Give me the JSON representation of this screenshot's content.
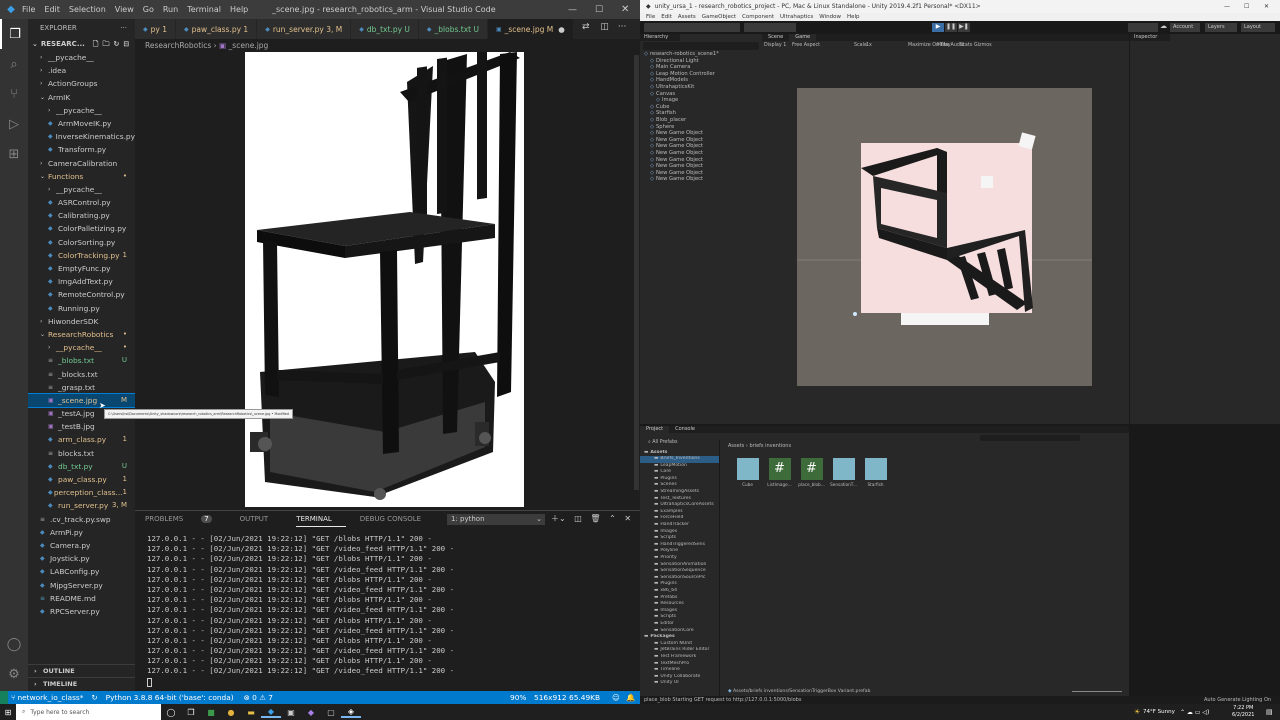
{
  "vscode": {
    "menu": [
      "File",
      "Edit",
      "Selection",
      "View",
      "Go",
      "Run",
      "Terminal",
      "Help"
    ],
    "title": "_scene.jpg - research_robotics_arm - Visual Studio Code",
    "explorer_label": "EXPLORER",
    "explorer_root": "RESEARC...",
    "tree": [
      {
        "label": "__pycache__",
        "indent": 1,
        "folder": true,
        "color": "#ccc",
        "badge": ""
      },
      {
        "label": ".idea",
        "indent": 1,
        "folder": true,
        "color": "#ccc",
        "badge": ""
      },
      {
        "label": "ActionGroups",
        "indent": 1,
        "folder": true,
        "color": "#ccc",
        "badge": ""
      },
      {
        "label": "ArmIK",
        "indent": 1,
        "folder": true,
        "open": true,
        "color": "#ccc",
        "badge": ""
      },
      {
        "label": "__pycache__",
        "indent": 2,
        "folder": true,
        "color": "#ccc",
        "badge": ""
      },
      {
        "label": "ArmMoveIK.py",
        "indent": 2,
        "file": "py",
        "color": "#ccc",
        "badge": ""
      },
      {
        "label": "InverseKinematics.py",
        "indent": 2,
        "file": "py",
        "color": "#ccc",
        "badge": ""
      },
      {
        "label": "Transform.py",
        "indent": 2,
        "file": "py",
        "color": "#ccc",
        "badge": ""
      },
      {
        "label": "CameraCalibration",
        "indent": 1,
        "folder": true,
        "color": "#ccc",
        "badge": ""
      },
      {
        "label": "Functions",
        "indent": 1,
        "folder": true,
        "open": true,
        "color": "#e2c08d",
        "badge": "•"
      },
      {
        "label": "__pycache__",
        "indent": 2,
        "folder": true,
        "color": "#ccc",
        "badge": ""
      },
      {
        "label": "ASRControl.py",
        "indent": 2,
        "file": "py",
        "color": "#ccc",
        "badge": ""
      },
      {
        "label": "Calibrating.py",
        "indent": 2,
        "file": "py",
        "color": "#ccc",
        "badge": ""
      },
      {
        "label": "ColorPalletizing.py",
        "indent": 2,
        "file": "py",
        "color": "#ccc",
        "badge": ""
      },
      {
        "label": "ColorSorting.py",
        "indent": 2,
        "file": "py",
        "color": "#ccc",
        "badge": ""
      },
      {
        "label": "ColorTracking.py",
        "indent": 2,
        "file": "py",
        "color": "#e2c08d",
        "badge": "1"
      },
      {
        "label": "EmptyFunc.py",
        "indent": 2,
        "file": "py",
        "color": "#ccc",
        "badge": ""
      },
      {
        "label": "ImgAddText.py",
        "indent": 2,
        "file": "py",
        "color": "#ccc",
        "badge": ""
      },
      {
        "label": "RemoteControl.py",
        "indent": 2,
        "file": "py",
        "color": "#ccc",
        "badge": ""
      },
      {
        "label": "Running.py",
        "indent": 2,
        "file": "py",
        "color": "#ccc",
        "badge": ""
      },
      {
        "label": "HiwonderSDK",
        "indent": 1,
        "folder": true,
        "color": "#ccc",
        "badge": ""
      },
      {
        "label": "ResearchRobotics",
        "indent": 1,
        "folder": true,
        "open": true,
        "color": "#e2c08d",
        "badge": "•"
      },
      {
        "label": "__pycache__",
        "indent": 2,
        "folder": true,
        "color": "#e2c08d",
        "badge": "•"
      },
      {
        "label": "_blobs.txt",
        "indent": 2,
        "file": "txt",
        "color": "#73c991",
        "badge": "U"
      },
      {
        "label": "_blocks.txt",
        "indent": 2,
        "file": "txt",
        "color": "#ccc",
        "badge": ""
      },
      {
        "label": "_grasp.txt",
        "indent": 2,
        "file": "txt",
        "color": "#ccc",
        "badge": ""
      },
      {
        "label": "_scene.jpg",
        "indent": 2,
        "file": "img",
        "color": "#e2c08d",
        "badge": "M",
        "selected": true
      },
      {
        "label": "_testA.jpg",
        "indent": 2,
        "file": "img",
        "color": "#ccc",
        "badge": ""
      },
      {
        "label": "_testB.jpg",
        "indent": 2,
        "file": "img",
        "color": "#ccc",
        "badge": ""
      },
      {
        "label": "arm_class.py",
        "indent": 2,
        "file": "py",
        "color": "#e2c08d",
        "badge": "1"
      },
      {
        "label": "blocks.txt",
        "indent": 2,
        "file": "txt",
        "color": "#ccc",
        "badge": ""
      },
      {
        "label": "db_txt.py",
        "indent": 2,
        "file": "py",
        "color": "#73c991",
        "badge": "U"
      },
      {
        "label": "paw_class.py",
        "indent": 2,
        "file": "py",
        "color": "#e2c08d",
        "badge": "1"
      },
      {
        "label": "perception_class...",
        "indent": 2,
        "file": "py",
        "color": "#e2c08d",
        "badge": "1"
      },
      {
        "label": "run_server.py",
        "indent": 2,
        "file": "py",
        "color": "#e2c08d",
        "badge": "3, M"
      },
      {
        "label": ".cv_track.py.swp",
        "indent": 1,
        "file": "txt",
        "color": "#ccc",
        "badge": ""
      },
      {
        "label": "ArmPi.py",
        "indent": 1,
        "file": "py",
        "color": "#ccc",
        "badge": ""
      },
      {
        "label": "Camera.py",
        "indent": 1,
        "file": "py",
        "color": "#ccc",
        "badge": ""
      },
      {
        "label": "Joystick.py",
        "indent": 1,
        "file": "py",
        "color": "#ccc",
        "badge": ""
      },
      {
        "label": "LABConfig.py",
        "indent": 1,
        "file": "py",
        "color": "#ccc",
        "badge": ""
      },
      {
        "label": "MjpgServer.py",
        "indent": 1,
        "file": "py",
        "color": "#ccc",
        "badge": ""
      },
      {
        "label": "README.md",
        "indent": 1,
        "file": "md",
        "color": "#ccc",
        "badge": ""
      },
      {
        "label": "RPCServer.py",
        "indent": 1,
        "file": "py",
        "color": "#ccc",
        "badge": ""
      }
    ],
    "outline": "OUTLINE",
    "timeline": "TIMELINE",
    "tabs": [
      {
        "label": "py 1",
        "color": "#e2c08d"
      },
      {
        "label": "paw_class.py 1",
        "color": "#e2c08d"
      },
      {
        "label": "run_server.py 3, M",
        "color": "#e2c08d"
      },
      {
        "label": "db_txt.py U",
        "color": "#73c991"
      },
      {
        "label": "_blobs.txt U",
        "color": "#73c991"
      },
      {
        "label": "_scene.jpg M",
        "color": "#e2c08d",
        "active": true
      }
    ],
    "breadcrumb": [
      "ResearchRobotics",
      "_scene.jpg"
    ],
    "tooltip": "C:\\Users\\hsl\\Documents\\Unity_shadowcore\\research_robotics_arm\\ResearchRobotics\\_scene.jpg • Modified",
    "panel_tabs": [
      "PROBLEMS",
      "OUTPUT",
      "TERMINAL",
      "DEBUG CONSOLE"
    ],
    "problems_count": "7",
    "terminal_select": "1: python",
    "terminal_lines": [
      "127.0.0.1 - - [02/Jun/2021 19:22:12] \"GET /blobs HTTP/1.1\" 200 -",
      "127.0.0.1 - - [02/Jun/2021 19:22:12] \"GET /video_feed HTTP/1.1\" 200 -",
      "127.0.0.1 - - [02/Jun/2021 19:22:12] \"GET /blobs HTTP/1.1\" 200 -",
      "127.0.0.1 - - [02/Jun/2021 19:22:12] \"GET /video_feed HTTP/1.1\" 200 -",
      "127.0.0.1 - - [02/Jun/2021 19:22:12] \"GET /blobs HTTP/1.1\" 200 -",
      "127.0.0.1 - - [02/Jun/2021 19:22:12] \"GET /video_feed HTTP/1.1\" 200 -",
      "127.0.0.1 - - [02/Jun/2021 19:22:12] \"GET /blobs HTTP/1.1\" 200 -",
      "127.0.0.1 - - [02/Jun/2021 19:22:12] \"GET /video_feed HTTP/1.1\" 200 -",
      "127.0.0.1 - - [02/Jun/2021 19:22:12] \"GET /blobs HTTP/1.1\" 200 -",
      "127.0.0.1 - - [02/Jun/2021 19:22:12] \"GET /video_feed HTTP/1.1\" 200 -",
      "127.0.0.1 - - [02/Jun/2021 19:22:12] \"GET /blobs HTTP/1.1\" 200 -",
      "127.0.0.1 - - [02/Jun/2021 19:22:12] \"GET /video_feed HTTP/1.1\" 200 -",
      "127.0.0.1 - - [02/Jun/2021 19:22:12] \"GET /blobs HTTP/1.1\" 200 -",
      "127.0.0.1 - - [02/Jun/2021 19:22:12] \"GET /video_feed HTTP/1.1\" 200 -"
    ],
    "status": {
      "branch": "network_io_class*",
      "python": "Python 3.8.8 64-bit ('base': conda)",
      "problems": "⊗ 0 ⚠ 7",
      "zoom": "90%",
      "dims": "516x912",
      "size": "65.49KB"
    },
    "colors": {
      "accent": "#007acc",
      "modified": "#e2c08d",
      "untracked": "#73c991"
    }
  },
  "unity": {
    "title": "unity_ursa_1 - research_robotics_project - PC, Mac & Linux Standalone - Unity 2019.4.2f1 Personal* <DX11>",
    "menu": [
      "File",
      "Edit",
      "Assets",
      "GameObject",
      "Component",
      "Ultrahaptics",
      "Window",
      "Help"
    ],
    "toolbar_right": [
      "Account",
      "Layers",
      "Layout"
    ],
    "hierarchy_label": "Hierarchy",
    "scene_tabs": [
      "Scene",
      "Game"
    ],
    "game_bar": [
      "Display 1",
      "Free Aspect",
      "Scale",
      "1x",
      "Maximize On Play",
      "Mute Audio",
      "Stats",
      "Gizmos"
    ],
    "inspector_label": "Inspector",
    "hierarchy": [
      {
        "label": "research-robotics_scene1*",
        "indent": 0
      },
      {
        "label": "Directional Light",
        "indent": 1
      },
      {
        "label": "Main Camera",
        "indent": 1
      },
      {
        "label": "Leap Motion Controller",
        "indent": 1
      },
      {
        "label": "HandModels",
        "indent": 1
      },
      {
        "label": "UltrahapticsKit",
        "indent": 1
      },
      {
        "label": "Canvas",
        "indent": 1
      },
      {
        "label": "Image",
        "indent": 2
      },
      {
        "label": "Cube",
        "indent": 1
      },
      {
        "label": "Starfish",
        "indent": 1
      },
      {
        "label": "Blob_placer",
        "indent": 1
      },
      {
        "label": "Sphere",
        "indent": 1
      },
      {
        "label": "New Game Object",
        "indent": 1
      },
      {
        "label": "New Game Object",
        "indent": 1
      },
      {
        "label": "New Game Object",
        "indent": 1
      },
      {
        "label": "New Game Object",
        "indent": 1
      },
      {
        "label": "New Game Object",
        "indent": 1
      },
      {
        "label": "New Game Object",
        "indent": 1
      },
      {
        "label": "New Game Object",
        "indent": 1
      },
      {
        "label": "New Game Object",
        "indent": 1
      }
    ],
    "project_tabs": [
      "Project",
      "Console"
    ],
    "project_breadcrumb": "Assets › briefs inventions",
    "all_prefabs": "All Prefabs",
    "project_tree": [
      "Assets",
      "Briefs_Inventions",
      "LeapMotion",
      "Core",
      "Plugins",
      "Scenes",
      "StreamingAssets",
      "Test_Textures",
      "UltrahapticsCoreAssets",
      "Examples",
      "ForceField",
      "HandTracker",
      "Images",
      "Scripts",
      "HandTriggeredSens",
      "Polyline",
      "Priority",
      "SensationAnimation",
      "SensationSequence",
      "SensationSourcePlc",
      "Plugins",
      "x86_64",
      "Prefabs",
      "Resources",
      "Images",
      "Scripts",
      "Editor",
      "SensationCore",
      "Packages",
      "Custom NUnit",
      "JetBrains Rider Editor",
      "Test Framework",
      "TextMeshPro",
      "Timeline",
      "Unity Collaborate",
      "Unity UI"
    ],
    "assets": [
      "Cube",
      "ListImage...",
      "place_blob...",
      "SensationT...",
      "Starfish"
    ],
    "project_footer": "Assets/briefs inventions/SensationTriggerBox Variant.prefab",
    "status": "place_blob Starting GET request to http://127.0.0.1:5000/blobs",
    "status_right": "Auto Generate Lighting On"
  },
  "taskbar": {
    "search_placeholder": "Type here to search",
    "weather": "74°F Sunny",
    "time": "7:22 PM",
    "date": "6/2/2021"
  }
}
